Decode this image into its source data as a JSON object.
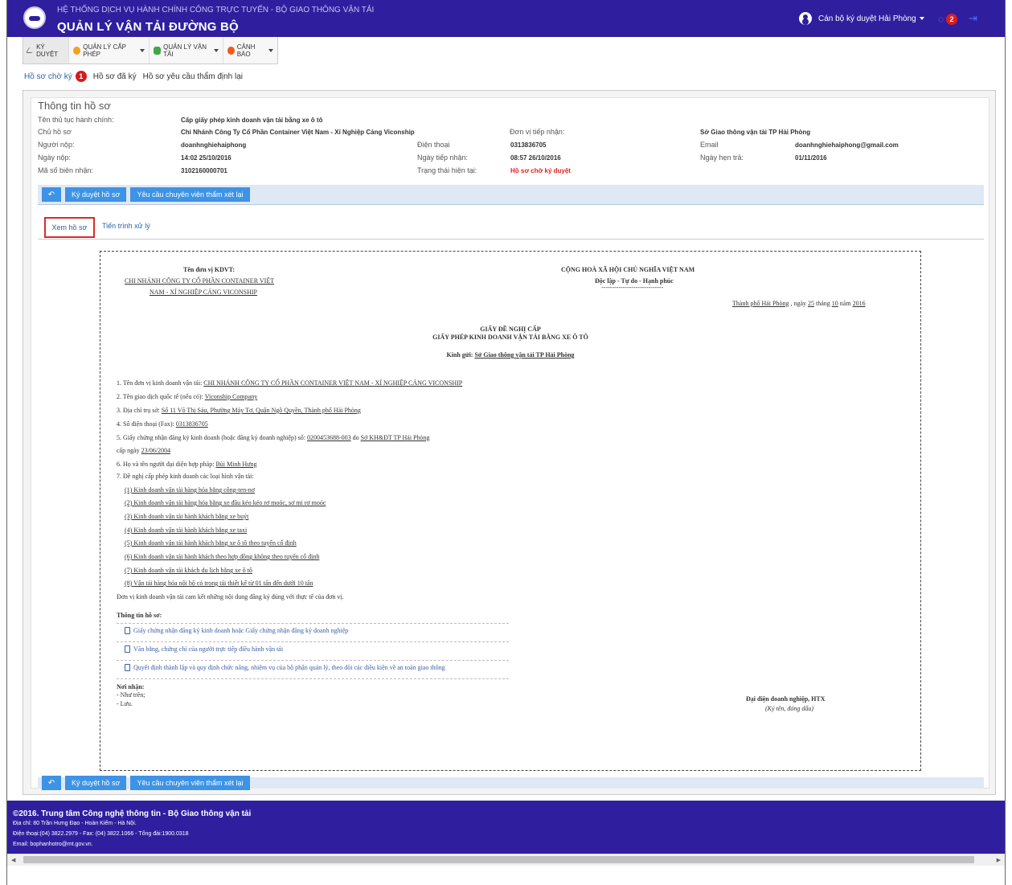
{
  "header": {
    "system_title": "HỆ THỐNG DỊCH VỤ HÀNH CHÍNH CÔNG TRỰC TUYẾN - BỘ GIAO THÔNG VẬN TẢI",
    "app_title": "QUẢN LÝ VẬN TẢI ĐƯỜNG BỘ",
    "user_name": "Cán bộ ký duyệt Hải Phòng",
    "notification_count": "2"
  },
  "menu": [
    {
      "label": "KÝ DUYỆT"
    },
    {
      "label": "QUẢN LÝ CẤP PHÉP"
    },
    {
      "label": "QUẢN LÝ VẬN TẢI"
    },
    {
      "label": "CẢNH BÁO"
    }
  ],
  "subtabs": [
    {
      "label": "Hồ sơ chờ ký",
      "badge": "1"
    },
    {
      "label": "Hồ sơ đã ký"
    },
    {
      "label": "Hồ sơ yêu cầu thẩm định lại"
    }
  ],
  "info": {
    "title": "Thông tin hồ sơ",
    "procedure_label": "Tên thủ tục hành chính:",
    "procedure_value": "Cấp giấy phép kinh doanh vận tải bằng xe ô tô",
    "owner_label": "Chủ hồ sơ",
    "owner_value": "Chi Nhánh Công Ty Cổ Phần Container Việt Nam - Xí Nghiệp Cảng Viconship",
    "receiver_label": "Đơn vị tiếp nhận:",
    "receiver_value": "Sở Giao thông vận tải TP Hải Phòng",
    "submitter_label": "Người nộp:",
    "submitter_value": "doanhnghiehaiphong",
    "phone_label": "Điện thoại",
    "phone_value": "0313836705",
    "email_label": "Email",
    "email_value": "doanhnghiehaiphong@gmail.com",
    "submit_date_label": "Ngày nộp:",
    "submit_date_value": "14:02 25/10/2016",
    "receive_date_label": "Ngày tiếp nhận:",
    "receive_date_value": "08:57 26/10/2016",
    "due_date_label": "Ngày hẹn trả:",
    "due_date_value": "01/11/2016",
    "receipt_code_label": "Mã số biên nhận:",
    "receipt_code_value": "3102160000701",
    "status_label": "Trạng thái hiện tại:",
    "status_value": "Hồ sơ chờ ký duyệt"
  },
  "actions": {
    "back_icon": "undo-icon",
    "approve_label": "Ký duyệt hồ sơ",
    "request_review_label": "Yêu cầu chuyên viên thẩm xét lại"
  },
  "tabs": {
    "view_label": "Xem hồ sơ",
    "process_label": "Tiến trình xử lý"
  },
  "document": {
    "unit_heading": "Tên đơn vị KDVT:",
    "unit_name_line1": "CHI NHÁNH CÔNG TY CỔ PHẦN CONTAINER VIỆT",
    "unit_name_line2": "NAM - XÍ NGHIỆP CẢNG VICONSHIP",
    "nation_line1": "CỘNG HOÀ XÃ HỘI CHỦ NGHĨA VIỆT NAM",
    "nation_line2": "Độc lập - Tự do - Hạnh phúc",
    "nation_rule": "-----------------------------",
    "place_date_city": "Thành phố Hải Phòng",
    "place_date_day_label": ", ngày",
    "place_date_day": "25",
    "place_date_month_label": "tháng",
    "place_date_month": "10",
    "place_date_year_label": "năm",
    "place_date_year": "2016",
    "title_line1": "GIẤY ĐỀ NGHỊ CẤP",
    "title_line2": "GIẤY PHÉP KINH DOANH VẬN TẢI BẰNG XE Ô TÔ",
    "to_label": "Kính gửi:",
    "to_value": "Sở Giao thông vận tải TP Hải Phòng",
    "items": [
      {
        "label": "1. Tên đơn vị kinh doanh vận tải:",
        "value": "CHI NHÁNH CÔNG TY CỔ PHẦN CONTAINER VIỆT NAM - XÍ NGHIỆP CẢNG VICONSHIP"
      },
      {
        "label": "2. Tên giao dịch quốc tế (nếu có):",
        "value": "Viconship Company"
      },
      {
        "label": "3. Địa chỉ trụ sở:",
        "value": "Số 11 Võ Thị Sáu, Phường Máy Tơ, Quận Ngô Quyền, Thành phố Hải Phòng"
      },
      {
        "label": "4. Số điện thoại (Fax):",
        "value": "0313836705"
      }
    ],
    "item5_label": "5. Giấy chứng nhận đăng ký kinh doanh (hoặc đăng ký doanh nghiệp) số:",
    "item5_number": "0200453688-003",
    "item5_by_label": "do",
    "item5_by": "Sở KH&ĐT TP Hải Phòng",
    "item5_date_label": "cấp ngày",
    "item5_date": "23/06/2004",
    "item6_label": "6. Họ và tên người đại diện hợp pháp:",
    "item6_value": "Bùi Minh Hưng",
    "item7_label": "7. Đề nghị cấp phép kinh doanh các loại hình vận tải:",
    "transport_types": [
      "(1) Kinh doanh vận tải hàng hóa bằng công-ten-nơ",
      "(2) Kinh doanh vận tải hàng hóa bằng xe đầu kéo kéo rơ moóc, sơ mi rơ moóc",
      "(3) Kinh doanh vận tải hành khách bằng xe buýt",
      "(4) Kinh doanh vận tải hành khách bằng xe taxi",
      "(5) Kinh doanh vận tải hành khách bằng xe ô tô theo tuyến cố định",
      "(6) Kinh doanh vận tải hành khách theo hợp đồng không theo tuyến cố định",
      "(7) Kinh doanh vận tải khách du lịch bằng xe ô tô",
      "(8) Vận tải hàng hóa nội bộ có trọng tải thiết kế từ 01 tấn đến dưới 10 tấn"
    ],
    "commitment": "Đơn vị kinh doanh vận tải cam kết những nội dung đăng ký đúng với thực tế của đơn vị.",
    "attachments_heading": "Thông tin hồ sơ:",
    "attachments": [
      "Giấy chứng nhận đăng ký kinh doanh hoặc Giấy chứng nhận đăng ký doanh nghiệp",
      "Văn bằng, chứng chỉ của người trực tiếp điều hành vận tải",
      "Quyết định thành lập và quy định chức năng, nhiệm vụ của bộ phận quản lý, theo dõi các điều kiện về an toàn giao thông"
    ],
    "recipients_heading": "Nơi nhận:",
    "recipients": [
      "- Như trên;",
      "- Lưu."
    ],
    "signer_title": "Đại diện doanh nghiệp, HTX",
    "signer_note": "(Ký tên, đóng dấu)"
  },
  "footer": {
    "copyright": "©2016. Trung tâm Công nghệ thông tin - Bộ Giao thông vận tải",
    "address": "Địa chỉ: 80 Trần Hưng Đạo - Hoàn Kiếm - Hà Nội.",
    "phone": "Điện thoại:(04) 3822.2979 - Fax: (04) 3822.1066 - Tổng đài:1900.0318",
    "email": "Email: bophanhotro@mt.gov.vn."
  }
}
